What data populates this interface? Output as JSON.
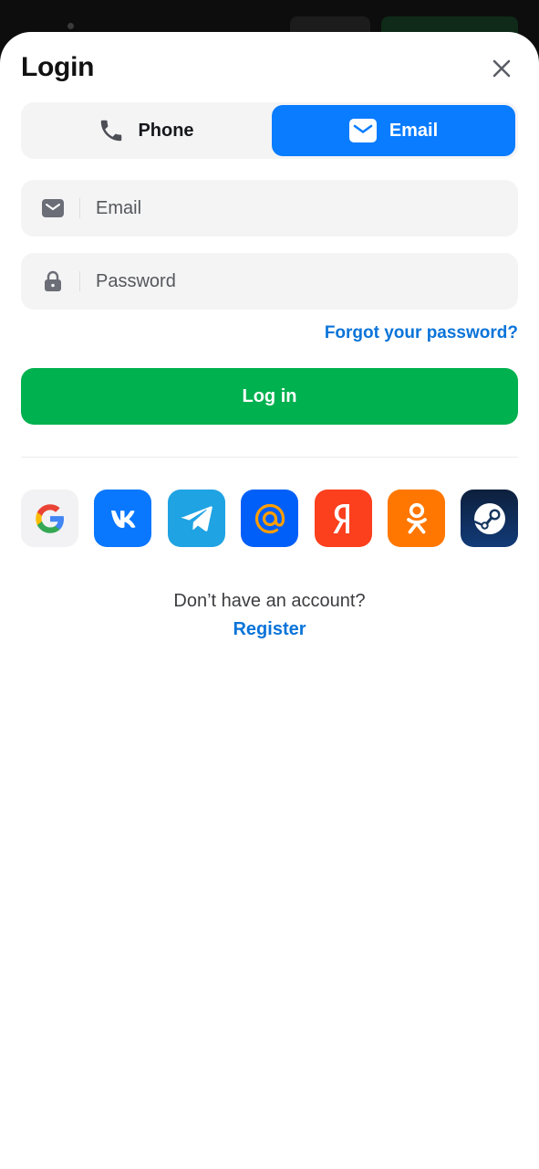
{
  "header": {
    "title": "Login",
    "close_icon": "close-icon"
  },
  "tabs": [
    {
      "label": "Phone",
      "icon": "phone-icon",
      "selected": false
    },
    {
      "label": "Email",
      "icon": "envelope-icon",
      "selected": true
    }
  ],
  "form": {
    "email": {
      "placeholder": "Email",
      "value": "",
      "icon": "envelope-icon"
    },
    "password": {
      "placeholder": "Password",
      "value": "",
      "icon": "lock-icon"
    },
    "forgot_label": "Forgot your password?",
    "login_label": "Log in"
  },
  "social": [
    {
      "name": "Google",
      "icon": "google-icon",
      "color": "#f2f2f4"
    },
    {
      "name": "VK",
      "icon": "vk-icon",
      "color": "#0a77ff"
    },
    {
      "name": "Telegram",
      "icon": "telegram-icon",
      "color": "#1fa3e3"
    },
    {
      "name": "Mail.ru",
      "icon": "mailru-icon",
      "color": "#005ff9"
    },
    {
      "name": "Yandex",
      "icon": "yandex-icon",
      "color": "#fc3f1d"
    },
    {
      "name": "Odnoklassniki",
      "icon": "odnoklassniki-icon",
      "color": "#ff7700"
    },
    {
      "name": "Steam",
      "icon": "steam-icon",
      "color": "#0b2a55"
    }
  ],
  "footer": {
    "no_account_text": "Don’t have an account?",
    "register_label": "Register"
  },
  "colors": {
    "accent_blue": "#0a7cff",
    "link_blue": "#0a74d9",
    "login_green": "#00b14f",
    "field_bg": "#f4f4f5"
  }
}
